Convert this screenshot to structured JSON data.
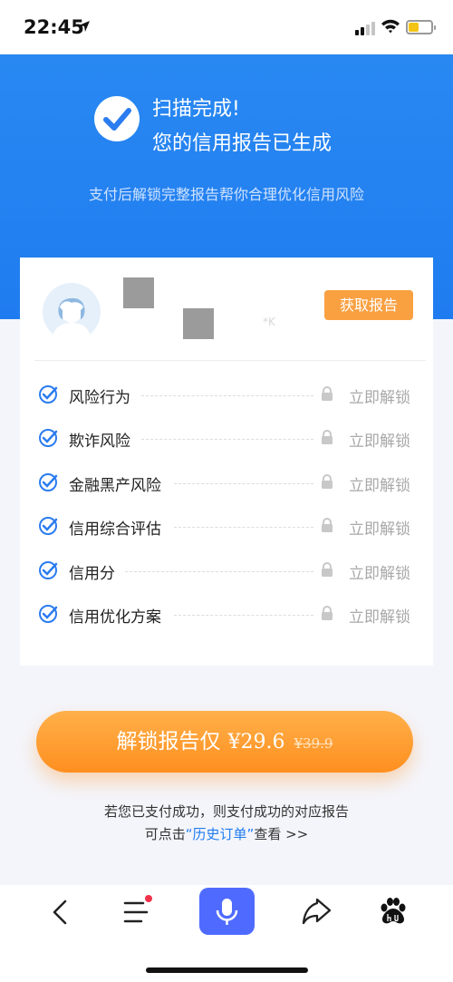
{
  "status_bar": {
    "time": "22:45"
  },
  "header": {
    "title_line1": "扫描完成!",
    "title_line2": "您的信用报告已生成",
    "subtitle": "支付后解锁完整报告帮你合理优化信用风险"
  },
  "card": {
    "masked_text": "*K",
    "get_report_label": "获取报告",
    "items": [
      {
        "label": "风险行为",
        "action": "立即解锁"
      },
      {
        "label": "欺诈风险",
        "action": "立即解锁"
      },
      {
        "label": "金融黑产风险",
        "action": "立即解锁"
      },
      {
        "label": "信用综合评估",
        "action": "立即解锁"
      },
      {
        "label": "信用分",
        "action": "立即解锁"
      },
      {
        "label": "信用优化方案",
        "action": "立即解锁"
      }
    ]
  },
  "cta": {
    "label": "解锁报告仅",
    "price": "¥29.6",
    "original_price": "¥39.9"
  },
  "notes": {
    "line1": "若您已支付成功，则支付成功的对应报告",
    "line2_prefix": "可点击",
    "line2_link": "“历史订单”",
    "line2_suffix": "查看 >>"
  },
  "bottom_nav": {
    "icons": [
      "back-icon",
      "menu-icon",
      "mic-icon",
      "share-icon",
      "baidu-paw-icon"
    ],
    "accent": "#4f6bff",
    "badge_color": "#f0334a"
  },
  "colors": {
    "primary_blue": "#1f7cf0",
    "orange": "#f9a041",
    "check_blue": "#2b7cf0"
  }
}
